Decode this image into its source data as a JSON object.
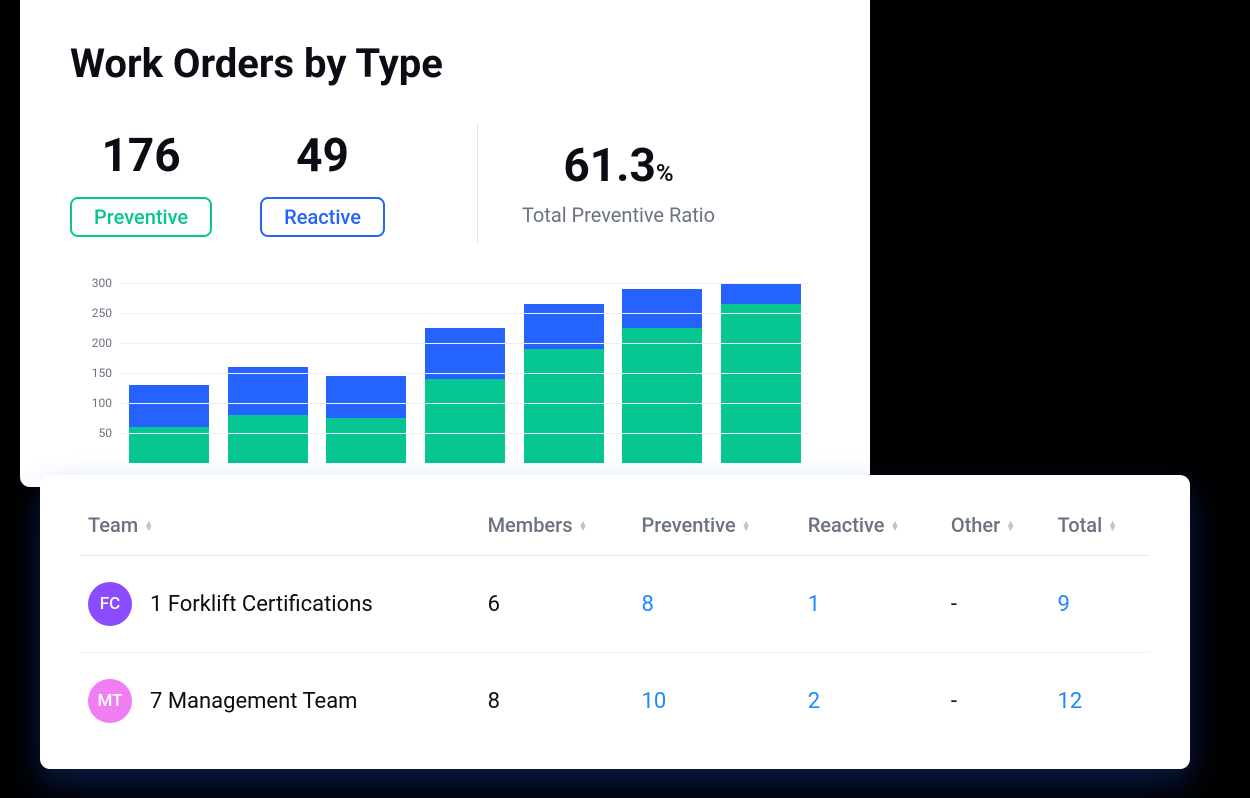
{
  "title": "Work Orders by Type",
  "stats": {
    "preventive": {
      "value": "176",
      "label": "Preventive"
    },
    "reactive": {
      "value": "49",
      "label": "Reactive"
    },
    "ratio": {
      "value": "61.3",
      "unit": "%",
      "label": "Total Preventive Ratio"
    }
  },
  "chart_data": {
    "type": "bar",
    "stacked": true,
    "ylim": [
      0,
      300
    ],
    "yticks": [
      50,
      100,
      150,
      200,
      250,
      300
    ],
    "series": [
      {
        "name": "Preventive",
        "color": "#06c691",
        "values": [
          60,
          80,
          75,
          140,
          190,
          225,
          265
        ]
      },
      {
        "name": "Reactive",
        "color": "#2563ff",
        "values": [
          70,
          80,
          70,
          85,
          75,
          65,
          35
        ]
      }
    ],
    "totals": [
      130,
      160,
      145,
      225,
      265,
      290,
      300
    ]
  },
  "table": {
    "columns": [
      "Team",
      "Members",
      "Preventive",
      "Reactive",
      "Other",
      "Total"
    ],
    "rows": [
      {
        "avatar": {
          "initials": "FC",
          "color": "#8b4bff"
        },
        "team": "1 Forklift Certifications",
        "members": "6",
        "preventive": "8",
        "reactive": "1",
        "other": "-",
        "total": "9"
      },
      {
        "avatar": {
          "initials": "MT",
          "color": "#f07ef2"
        },
        "team": "7 Management Team",
        "members": "8",
        "preventive": "10",
        "reactive": "2",
        "other": "-",
        "total": "12"
      }
    ]
  }
}
